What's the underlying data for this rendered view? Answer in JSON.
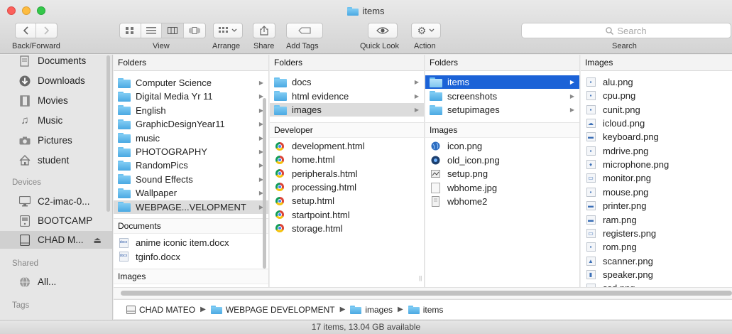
{
  "window": {
    "title": "items"
  },
  "toolbar": {
    "back_forward_label": "Back/Forward",
    "view_label": "View",
    "arrange_label": "Arrange",
    "share_label": "Share",
    "add_tags_label": "Add Tags",
    "quick_look_label": "Quick Look",
    "action_label": "Action",
    "search_label": "Search",
    "search_placeholder": "Search"
  },
  "sidebar": {
    "favorites": [
      {
        "label": "Documents",
        "icon": "documents-icon"
      },
      {
        "label": "Downloads",
        "icon": "downloads-icon"
      },
      {
        "label": "Movies",
        "icon": "movies-icon"
      },
      {
        "label": "Music",
        "icon": "music-icon"
      },
      {
        "label": "Pictures",
        "icon": "pictures-icon"
      },
      {
        "label": "student",
        "icon": "home-icon"
      }
    ],
    "devices_heading": "Devices",
    "devices": [
      {
        "label": "C2-imac-0...",
        "icon": "imac-icon"
      },
      {
        "label": "BOOTCAMP",
        "icon": "disk-icon"
      },
      {
        "label": "CHAD M...",
        "icon": "drive-icon",
        "eject": "⏏"
      }
    ],
    "shared_heading": "Shared",
    "shared": [
      {
        "label": "All...",
        "icon": "network-icon"
      }
    ],
    "tags_heading": "Tags"
  },
  "column1": {
    "folders_heading": "Folders",
    "folders": [
      "Computer Science",
      "Digital Media Yr 11",
      "English",
      "GraphicDesignYear11",
      "music",
      "PHOTOGRAPHY",
      "RandomPics",
      "Sound Effects",
      "Wallpaper",
      "WEBPAGE...VELOPMENT"
    ],
    "documents_heading": "Documents",
    "documents": [
      "anime iconic item.docx",
      "tginfo.docx"
    ],
    "images_heading": "Images"
  },
  "column2": {
    "folders_heading": "Folders",
    "folders": [
      "docs",
      "html evidence",
      "images"
    ],
    "developer_heading": "Developer",
    "files": [
      "development.html",
      "home.html",
      "peripherals.html",
      "processing.html",
      "setup.html",
      "startpoint.html",
      "storage.html"
    ]
  },
  "column3": {
    "folders_heading": "Folders",
    "folders": [
      "items",
      "screenshots",
      "setupimages"
    ],
    "images_heading": "Images",
    "images": [
      "icon.png",
      "old_icon.png",
      "setup.png",
      "wbhome.jpg",
      "wbhome2"
    ]
  },
  "column4": {
    "images_heading": "Images",
    "images": [
      "alu.png",
      "cpu.png",
      "cunit.png",
      "icloud.png",
      "keyboard.png",
      "mdrive.png",
      "microphone.png",
      "monitor.png",
      "mouse.png",
      "printer.png",
      "ram.png",
      "registers.png",
      "rom.png",
      "scanner.png",
      "speaker.png",
      "ssd.png"
    ]
  },
  "pathbar": {
    "segments": [
      "CHAD MATEO",
      "WEBPAGE DEVELOPMENT",
      "images",
      "items"
    ]
  },
  "status": {
    "text": "17 items, 13.04 GB available"
  }
}
